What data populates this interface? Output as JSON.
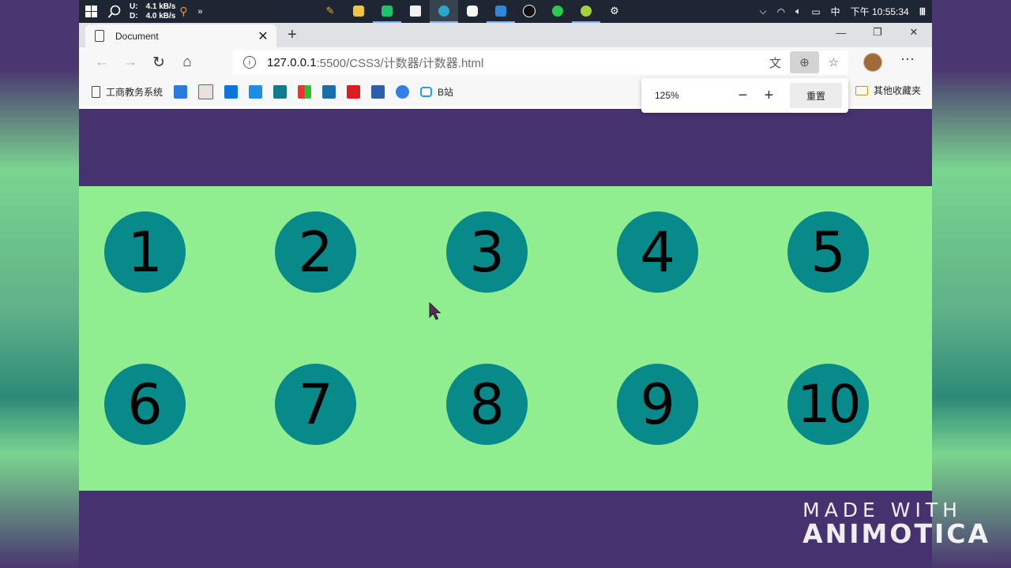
{
  "taskbar": {
    "net_upload_label": "U:",
    "net_upload_value": "4.1 kB/s",
    "net_download_label": "D:",
    "net_download_value": "4.0 kB/s",
    "ime": "中",
    "clock": "下午 10:55:34"
  },
  "browser": {
    "tab_title": "Document",
    "url_host": "127.0.0.1",
    "url_path": ":5500/CSS3/计数器/计数器.html",
    "favorites": [
      {
        "label": "工商教务系统"
      },
      {
        "label": "B站"
      }
    ],
    "other_favorites": "其他收藏夹",
    "zoom": {
      "level": "125%",
      "reset_label": "重置"
    }
  },
  "page": {
    "circles": [
      "1",
      "2",
      "3",
      "4",
      "5",
      "6",
      "7",
      "8",
      "9",
      "10"
    ]
  },
  "watermark": {
    "line1": "MADE WITH",
    "line2": "ANIMOTICA"
  },
  "colors": {
    "purple_band": "#473270",
    "green_area": "#90ee90",
    "circle_fill": "#088a8b"
  }
}
